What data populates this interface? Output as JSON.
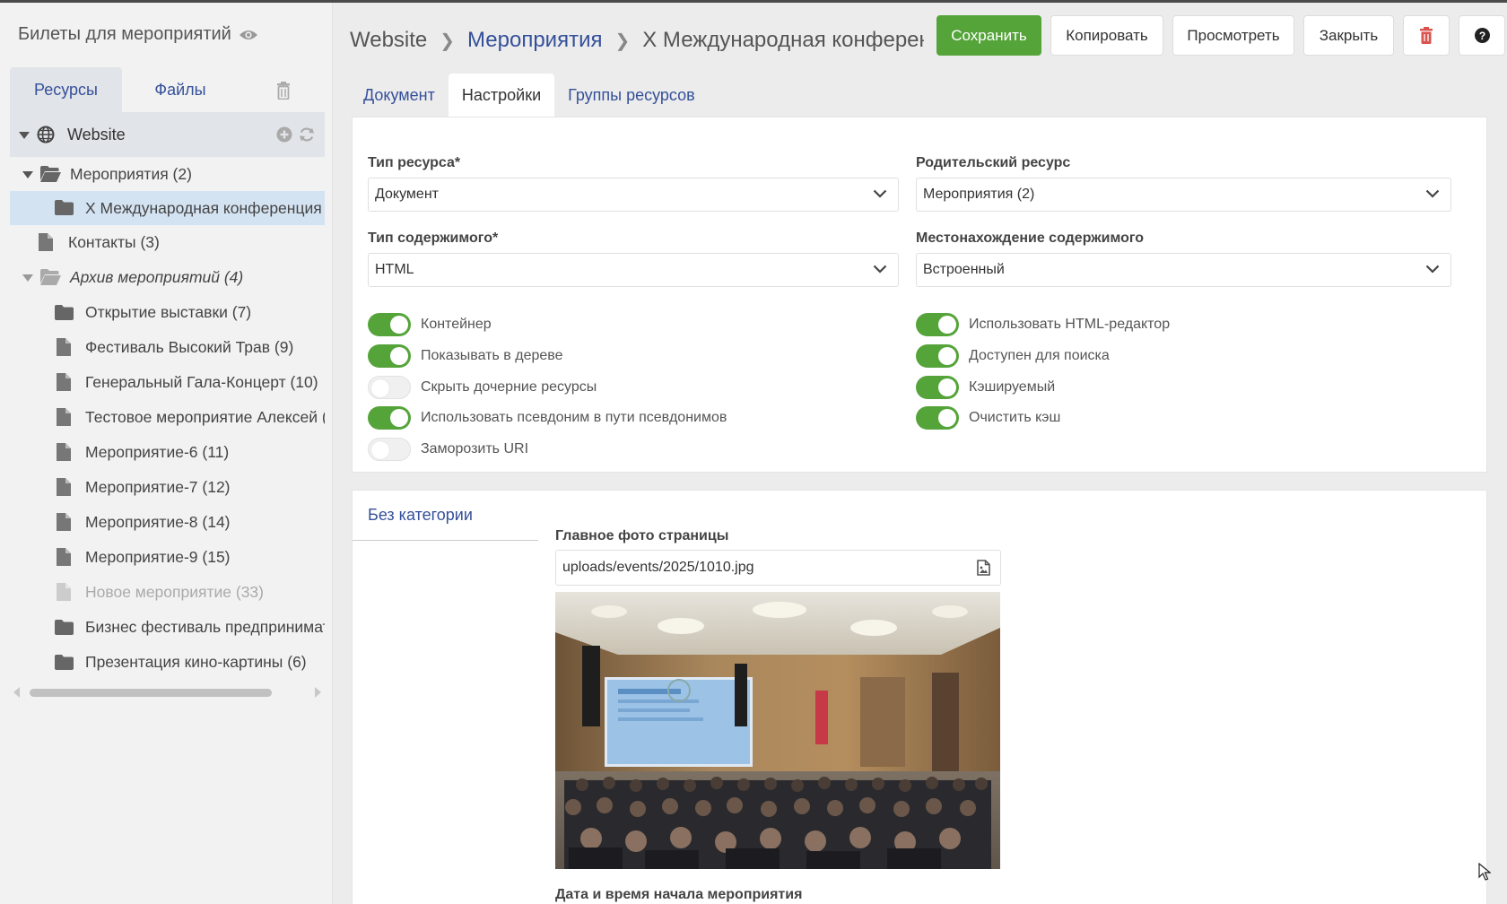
{
  "sidebar": {
    "site_title": "Билеты для мероприятий",
    "tabs": [
      "Ресурсы",
      "Файлы"
    ],
    "root": "Website",
    "tree": [
      {
        "label": "Мероприятия (2)",
        "type": "folder-open",
        "level": 0,
        "expanded": true
      },
      {
        "label": "X Международная конференция (",
        "type": "folder",
        "level": 1,
        "selected": true
      },
      {
        "label": "Контакты (3)",
        "type": "doc",
        "level": 0
      },
      {
        "label": "Архив мероприятий (4)",
        "type": "folder-open",
        "level": 0,
        "expanded": true,
        "italic": true
      },
      {
        "label": "Открытие выставки (7)",
        "type": "folder",
        "level": 1
      },
      {
        "label": "Фестиваль Высокий Трав (9)",
        "type": "doc",
        "level": 1
      },
      {
        "label": "Генеральный Гала-Концерт (10)",
        "type": "doc",
        "level": 1
      },
      {
        "label": "Тестовое мероприятие Алексей (",
        "type": "doc",
        "level": 1
      },
      {
        "label": "Мероприятие-6 (11)",
        "type": "doc",
        "level": 1
      },
      {
        "label": "Мероприятие-7 (12)",
        "type": "doc",
        "level": 1
      },
      {
        "label": "Мероприятие-8 (14)",
        "type": "doc",
        "level": 1
      },
      {
        "label": "Мероприятие-9 (15)",
        "type": "doc",
        "level": 1
      },
      {
        "label": "Новое мероприятие (33)",
        "type": "doc",
        "level": 1,
        "muted": true
      },
      {
        "label": "Бизнес фестиваль предпринимате",
        "type": "folder",
        "level": 1
      },
      {
        "label": "Презентация кино-картины (6)",
        "type": "folder",
        "level": 1
      }
    ]
  },
  "header": {
    "breadcrumb": [
      "Website",
      "Мероприятия",
      "X Международная конференц"
    ],
    "buttons": {
      "save": "Сохранить",
      "copy": "Копировать",
      "preview": "Просмотреть",
      "close": "Закрыть"
    }
  },
  "tabs": [
    "Документ",
    "Настройки",
    "Группы ресурсов"
  ],
  "settings": {
    "resource_type_label": "Тип ресурса*",
    "resource_type_value": "Документ",
    "parent_label": "Родительский ресурс",
    "parent_value": "Мероприятия (2)",
    "content_type_label": "Тип содержимого*",
    "content_type_value": "HTML",
    "content_location_label": "Местонахождение содержимого",
    "content_location_value": "Встроенный",
    "toggles_left": [
      {
        "label": "Контейнер",
        "on": true
      },
      {
        "label": "Показывать в дереве",
        "on": true
      },
      {
        "label": "Скрыть дочерние ресурсы",
        "on": false
      },
      {
        "label": "Использовать псевдоним в пути псевдонимов",
        "on": true
      },
      {
        "label": "Заморозить URI",
        "on": false
      }
    ],
    "toggles_right": [
      {
        "label": "Использовать HTML-редактор",
        "on": true
      },
      {
        "label": "Доступен для поиска",
        "on": true
      },
      {
        "label": "Кэшируемый",
        "on": true
      },
      {
        "label": "Очистить кэш",
        "on": true
      }
    ]
  },
  "tv": {
    "category_tab": "Без категории",
    "photo_label": "Главное фото страницы",
    "photo_path": "uploads/events/2025/1010.jpg",
    "date_label": "Дата и время начала мероприятия"
  },
  "colors": {
    "accent": "#54a43a",
    "link": "#35509a",
    "danger": "#d9534f"
  }
}
